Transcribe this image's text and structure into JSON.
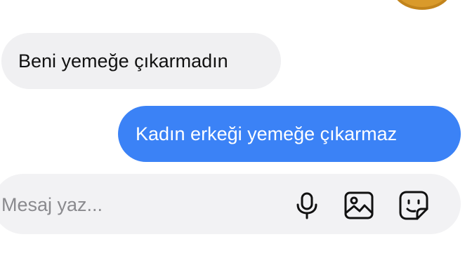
{
  "messages": [
    {
      "direction": "incoming",
      "text": "Beni yemeğe çıkarmadın"
    },
    {
      "direction": "outgoing",
      "text": "Kadın erkeği yemeğe çıkarmaz"
    }
  ],
  "composer": {
    "placeholder": "Mesaj yaz...",
    "value": "",
    "icons": [
      "microphone-icon",
      "image-gallery-icon",
      "sticker-icon"
    ]
  },
  "colors": {
    "incoming_bubble": "#f0f0f2",
    "outgoing_bubble": "#3b82f6",
    "composer_bg": "#f2f2f4",
    "icon": "#111111"
  }
}
